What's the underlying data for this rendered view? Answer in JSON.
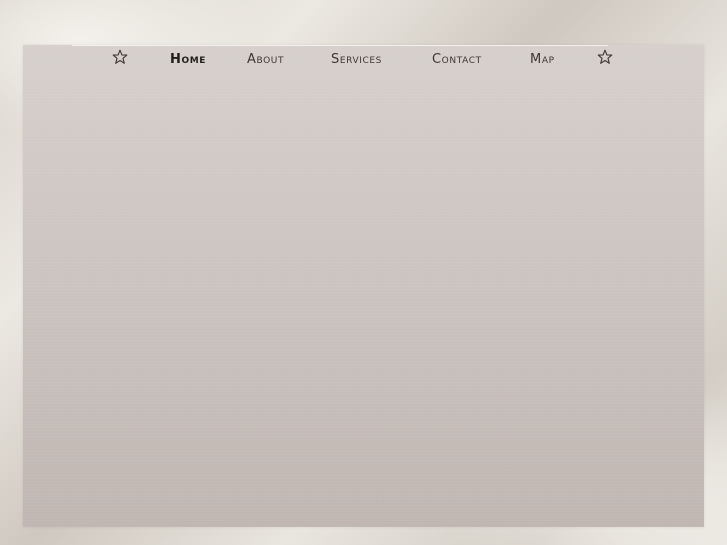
{
  "nav": {
    "items": [
      {
        "label": "Home",
        "active": true
      },
      {
        "label": "About",
        "active": false
      },
      {
        "label": "Services",
        "active": false
      },
      {
        "label": "Contact",
        "active": false
      },
      {
        "label": "Map",
        "active": false
      }
    ],
    "left_icon": "star-icon",
    "right_icon": "star-icon"
  },
  "colors": {
    "panel_top": "#d6cfcb",
    "panel_bottom": "#bfb6b2",
    "nav_text": "#3c3534"
  }
}
